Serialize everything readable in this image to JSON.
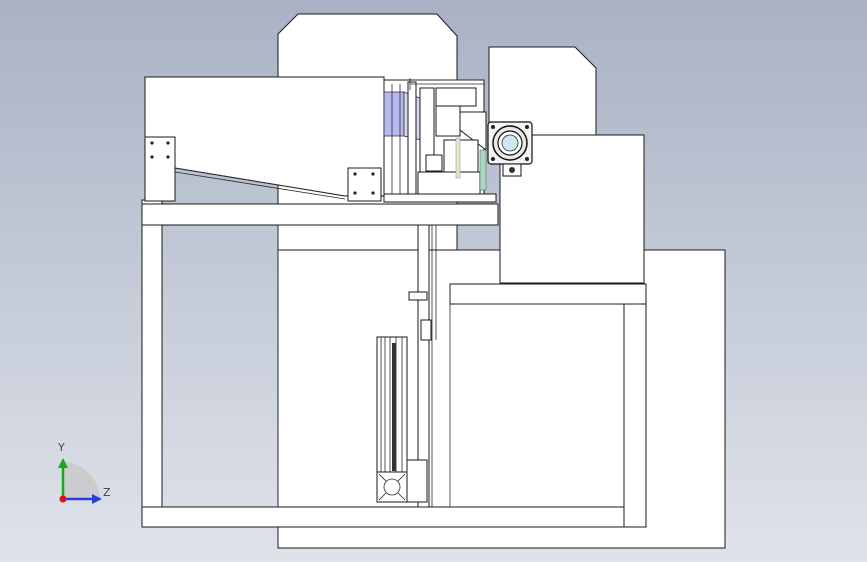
{
  "triad": {
    "y_label": "Y",
    "z_label": "Z",
    "colors": {
      "y": "#1ca81c",
      "z": "#2a3ee0",
      "x": "#e01010"
    }
  },
  "colors": {
    "background_top": "#a9b2c4",
    "background_bottom": "#dfe3ea",
    "part_fill": "#ffffff",
    "edge": "#1a1a1a",
    "highlight_blue": "#b7b9f0"
  }
}
